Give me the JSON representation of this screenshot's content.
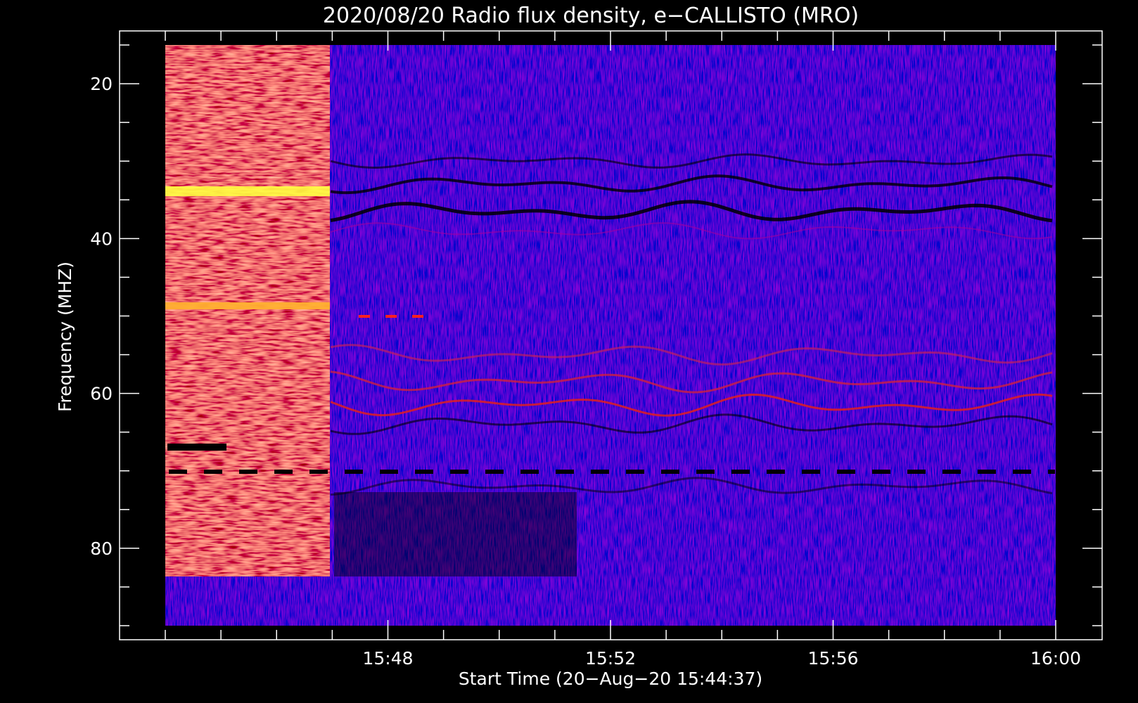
{
  "chart_data": {
    "type": "heatmap",
    "title": "2020/08/20  Radio flux density, e−CALLISTO (MRO)",
    "xlabel": "Start Time (20−Aug−20 15:44:37)",
    "ylabel": "Frequency (MHZ)",
    "x_ticks": [
      "15:48",
      "15:52",
      "15:56",
      "16:00"
    ],
    "y_ticks": [
      "20",
      "40",
      "60",
      "80"
    ],
    "y_axis_inverted": true,
    "x_range": [
      "15:44:37",
      "16:00:07"
    ],
    "y_range_mhz": [
      15,
      90
    ],
    "colormap": [
      "#000000",
      "#0000ff",
      "#ff0000",
      "#ffff00"
    ],
    "features": [
      {
        "label": "",
        "time_range": [
          "15:44:37",
          "15:47:22"
        ],
        "freq_range_mhz": [
          15,
          85
        ],
        "intensity": "high (red/orange)"
      },
      {
        "label": "",
        "freq_mhz": 35,
        "time_range": [
          "15:44:37",
          "15:47:22"
        ],
        "intensity": "max (yellow)"
      },
      {
        "label": "",
        "freq_mhz": 49.5,
        "time_range": [
          "15:44:37",
          "15:47:22"
        ],
        "intensity": "max (orange)"
      }
    ]
  }
}
